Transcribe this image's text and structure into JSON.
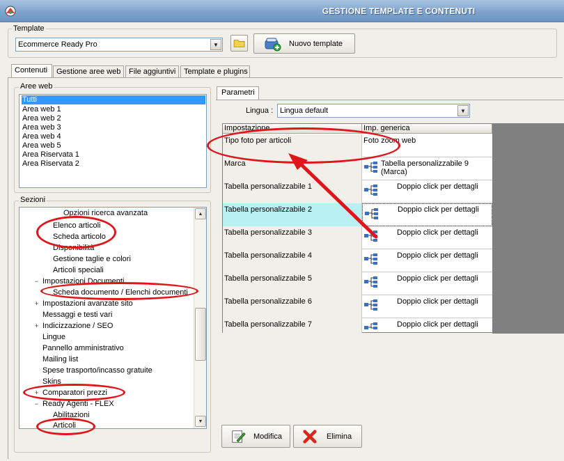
{
  "window": {
    "title": "GESTIONE TEMPLATE E CONTENUTI"
  },
  "template_group": {
    "label": "Template",
    "selected": "Ecommerce Ready Pro",
    "new_button": "Nuovo template"
  },
  "tabs": [
    "Contenuti",
    "Gestione aree web",
    "File aggiuntivi",
    "Template e plugins"
  ],
  "aree_web": {
    "label": "Aree web",
    "items": [
      "Tutti",
      "Area web 1",
      "Area web 2",
      "Area web 3",
      "Area web 4",
      "Area web 5",
      "Area Riservata 1",
      "Area Riservata 2"
    ]
  },
  "sezioni": {
    "label": "Sezioni",
    "items": [
      "Opzioni ricerca avanzata",
      "Elenco articoli",
      "Scheda articolo",
      "Disponibilità",
      "Gestione taglie e colori",
      "Articoli speciali",
      "Impostazioni Documenti",
      "Scheda documento / Elenchi documenti",
      "Impostazioni avanzate sito",
      "Messaggi e testi vari",
      "Indicizzazione / SEO",
      "Lingue",
      "Pannello amministrativo",
      "Mailing list",
      "Spese trasporto/incasso gratuite",
      "Skins",
      "Comparatori prezzi",
      "Ready Agenti - FLEX",
      "Abilitazioni",
      "Articoli"
    ]
  },
  "parametri": {
    "tab": "Parametri",
    "lingua_label": "Lingua :",
    "lingua_value": "Lingua default",
    "columns": [
      "Impostazione",
      "Imp. generica"
    ],
    "rows": [
      {
        "name": "Tipo foto per articoli",
        "value": "Foto zoom web"
      },
      {
        "name": "Marca",
        "value": "Tabella personalizzabile 9 (Marca)"
      },
      {
        "name": "Tabella personalizzabile 1",
        "value": "Doppio click per dettagli"
      },
      {
        "name": "Tabella personalizzabile 2",
        "value": "Doppio click per dettagli"
      },
      {
        "name": "Tabella personalizzabile 3",
        "value": "Doppio click per dettagli"
      },
      {
        "name": "Tabella personalizzabile 4",
        "value": "Doppio click per dettagli"
      },
      {
        "name": "Tabella personalizzabile 5",
        "value": "Doppio click per dettagli"
      },
      {
        "name": "Tabella personalizzabile 6",
        "value": "Doppio click per dettagli"
      },
      {
        "name": "Tabella personalizzabile 7",
        "value": "Doppio click per dettagli"
      }
    ]
  },
  "actions": {
    "modifica": "Modifica",
    "elimina": "Elimina"
  },
  "colors": {
    "annotation": "#e0151a",
    "selection": "#3399ff",
    "highlight_row": "#b9f1f3"
  }
}
